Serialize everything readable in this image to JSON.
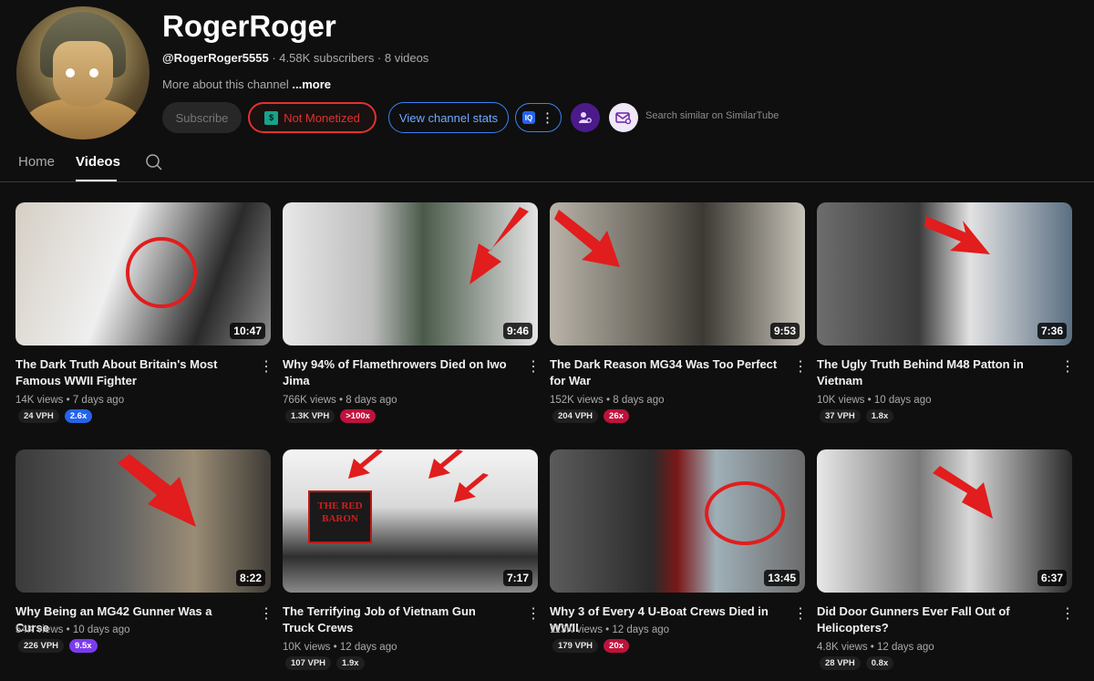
{
  "channel": {
    "name": "RogerRoger",
    "handle": "@RogerRoger5555",
    "meta_rest": " · 4.58K subscribers · 8 videos",
    "about": "More about this channel ",
    "more": "...more"
  },
  "buttons": {
    "subscribe": "Subscribe",
    "not_monetized": "Not Monetized",
    "view_stats": "View channel stats",
    "iq_label": "IQ",
    "similar": "Search similar on SimilarTube"
  },
  "tabs": {
    "home": "Home",
    "videos": "Videos"
  },
  "videos": [
    {
      "title": "The Dark Truth About Britain's Most Famous WWII Fighter",
      "duration": "10:47",
      "stats": "14K views • 7 days ago",
      "vph": "24 VPH",
      "ratio": "2.6x",
      "ratio_color": "blue"
    },
    {
      "title": "Why 94% of Flamethrowers Died on Iwo Jima",
      "duration": "9:46",
      "stats": "766K views • 8 days ago",
      "vph": "1.3K VPH",
      "ratio": ">100x",
      "ratio_color": "red"
    },
    {
      "title": "The Dark Reason MG34 Was Too Perfect for War",
      "duration": "9:53",
      "stats": "152K views • 8 days ago",
      "vph": "204 VPH",
      "ratio": "26x",
      "ratio_color": "red"
    },
    {
      "title": "The Ugly Truth Behind M48 Patton in Vietnam",
      "duration": "7:36",
      "stats": "10K views • 10 days ago",
      "vph": "37 VPH",
      "ratio": "1.8x",
      "ratio_color": "grey"
    },
    {
      "title": "Why Being an MG42 Gunner Was a Curse",
      "duration": "8:22",
      "stats": "54K views • 10 days ago",
      "vph": "226 VPH",
      "ratio": "9.5x",
      "ratio_color": "purple"
    },
    {
      "title": "The Terrifying Job of Vietnam Gun Truck Crews",
      "duration": "7:17",
      "stats": "10K views • 12 days ago",
      "vph": "107 VPH",
      "ratio": "1.9x",
      "ratio_color": "grey"
    },
    {
      "title": "Why 3 of Every 4 U-Boat Crews Died in WWII",
      "duration": "13:45",
      "stats": "113K views • 12 days ago",
      "vph": "179 VPH",
      "ratio": "20x",
      "ratio_color": "red"
    },
    {
      "title": "Did Door Gunners Ever Fall Out of Helicopters?",
      "duration": "6:37",
      "stats": "4.8K views • 12 days ago",
      "vph": "28 VPH",
      "ratio": "0.8x",
      "ratio_color": "grey"
    }
  ],
  "thumb_texts": {
    "truck_sign": "THE RED BARON"
  },
  "colors": {
    "background": "#0f0f0f",
    "accent_red": "#e0322f",
    "accent_blue": "#3b82f6"
  }
}
